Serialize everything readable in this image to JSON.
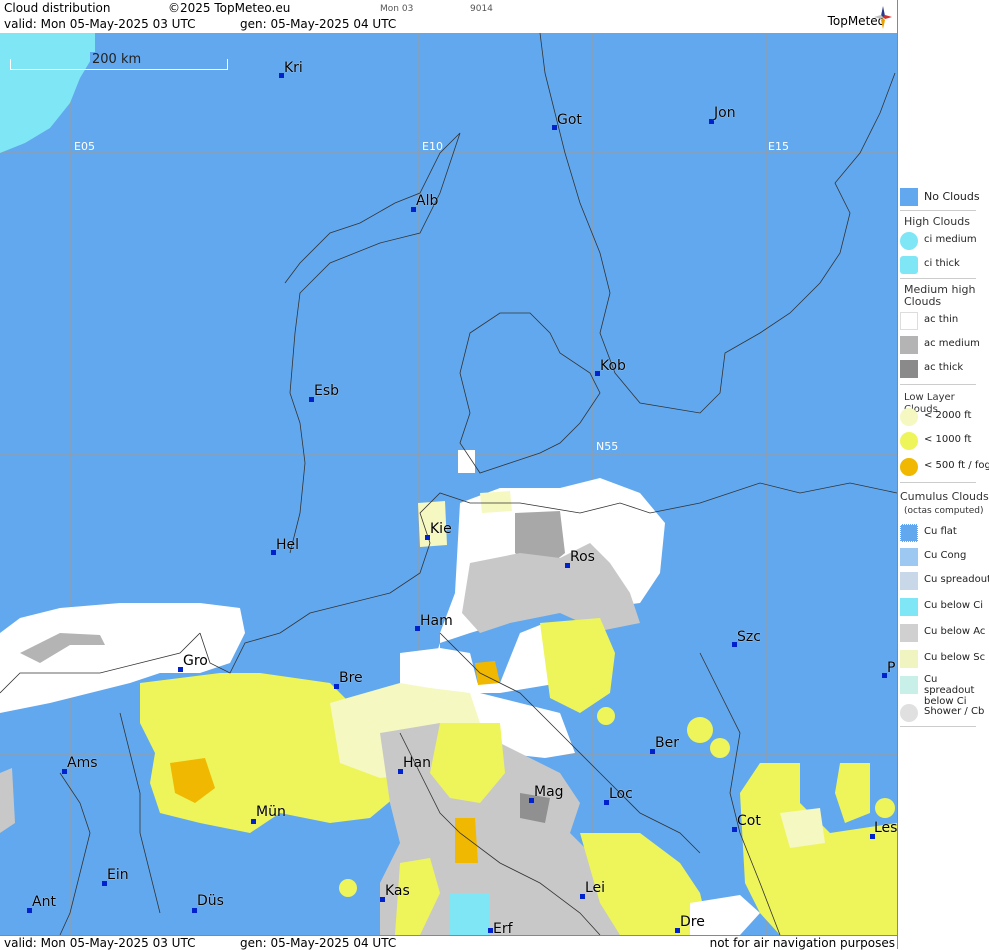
{
  "header": {
    "title": "Cloud distribution",
    "copyright": "©2025 TopMeteo.eu",
    "tag": "Mon 03",
    "code": "9014",
    "valid": "valid:  Mon  05-May-2025  03 UTC",
    "gen": "gen: 05-May-2025 04 UTC",
    "logo": "TopMeteo"
  },
  "footer": {
    "valid": "valid:  Mon  05-May-2025  03 UTC",
    "gen": "gen: 05-May-2025 04 UTC",
    "note": "not for air navigation purposes"
  },
  "map": {
    "scale_label": "200 km",
    "grid_labels": [
      "E05",
      "E10",
      "E15",
      "N55"
    ],
    "cities": [
      "Kri",
      "Got",
      "Jon",
      "Alb",
      "Kob",
      "Esb",
      "Kie",
      "Ros",
      "Hel",
      "Ham",
      "Szc",
      "P",
      "Gro",
      "Bre",
      "Ber",
      "Ams",
      "Han",
      "Mag",
      "Loc",
      "Mün",
      "Cot",
      "Les",
      "Ein",
      "Kas",
      "Lei",
      "Ant",
      "Düs",
      "Erf",
      "Dre"
    ]
  },
  "legend": {
    "no_clouds": "No Clouds",
    "high_header": "High Clouds",
    "ci_medium": "ci medium",
    "ci_thick": "ci thick",
    "medium_header": "Medium high Clouds",
    "ac_thin": "ac thin",
    "ac_medium": "ac medium",
    "ac_thick": "ac thick",
    "low_header": "Low Layer Clouds",
    "low_2000": "< 2000 ft",
    "low_1000": "< 1000 ft",
    "low_500": "< 500 ft / fog",
    "cu_header": "Cumulus Clouds",
    "cu_sub": "(octas computed)",
    "cu_flat": "Cu flat",
    "cu_cong": "Cu Cong",
    "cu_spreadout": "Cu spreadout",
    "cu_below_ci": "Cu below Ci",
    "cu_below_ac": "Cu below Ac",
    "cu_below_sc": "Cu below Sc",
    "cu_spread_below_ci": "Cu spreadout below Ci",
    "shower": "Shower / Cb",
    "colors": {
      "no_clouds": "#62a8ee",
      "ci_medium": "#7fe6f5",
      "ac_thin": "#ffffff",
      "ac_medium": "#b4b4b4",
      "ac_thick": "#8a8a8a",
      "low_2000": "#f5f8c0",
      "low_1000": "#eef55a",
      "low_500": "#f0b800"
    }
  }
}
